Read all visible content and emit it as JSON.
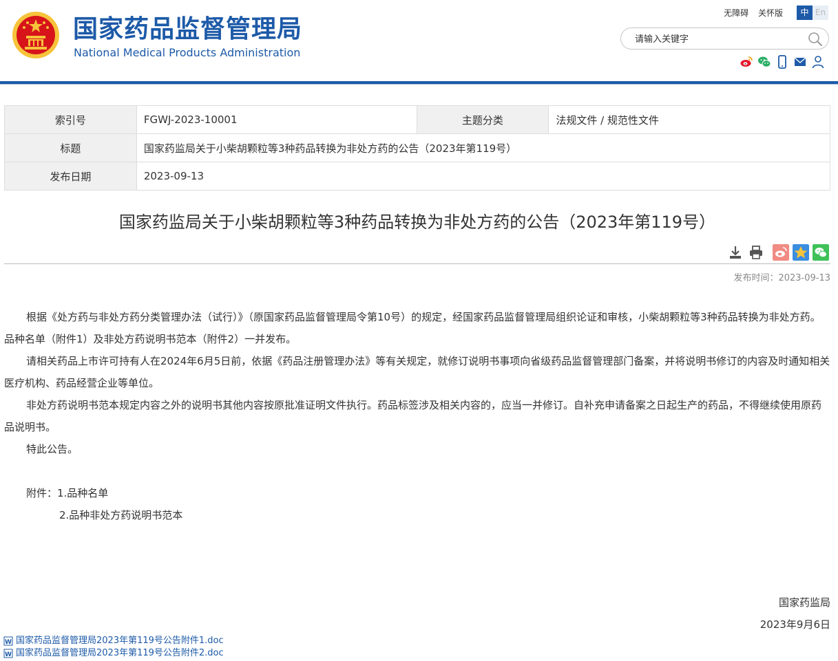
{
  "header": {
    "title_cn": "国家药品监督管理局",
    "title_en": "National Medical Products Administration",
    "accessibility": "无障碍",
    "elderly": "关怀版",
    "lang_zh": "中",
    "lang_en": "En",
    "search_placeholder": "请输入关键字",
    "share_icons": [
      "weibo-icon",
      "wechat-icon",
      "mobile-icon",
      "mail-icon",
      "user-icon"
    ]
  },
  "meta": {
    "index_label": "索引号",
    "index_value": "FGWJ-2023-10001",
    "category_label": "主题分类",
    "category_value": "法规文件 / 规范性文件",
    "title_label": "标题",
    "title_value": "国家药监局关于小柴胡颗粒等3种药品转换为非处方药的公告（2023年第119号）",
    "date_label": "发布日期",
    "date_value": "2023-09-13"
  },
  "article": {
    "title": "国家药监局关于小柴胡颗粒等3种药品转换为非处方药的公告（2023年第119号）",
    "publish_time": "发布时间：2023-09-13",
    "paragraphs": [
      "根据《处方药与非处方药分类管理办法（试行）》（原国家药品监督管理局令第10号）的规定，经国家药品监督管理局组织论证和审核，小柴胡颗粒等3种药品转换为非处方药。品种名单（附件1）及非处方药说明书范本（附件2）一并发布。",
      "请相关药品上市许可持有人在2024年6月5日前，依据《药品注册管理办法》等有关规定，就修订说明书事项向省级药品监督管理部门备案，并将说明书修订的内容及时通知相关医疗机构、药品经营企业等单位。",
      "非处方药说明书范本规定内容之外的说明书其他内容按原批准证明文件执行。药品标签涉及相关内容的，应当一并修订。自补充申请备案之日起生产的药品，不得继续使用原药品说明书。",
      "特此公告。"
    ],
    "attachment_1": "附件：1.品种名单",
    "attachment_2": "2.品种非处方药说明书范本",
    "signer": "国家药监局",
    "sign_date": "2023年9月6日",
    "files": [
      "国家药品监督管理局2023年第119号公告附件1.doc",
      "国家药品监督管理局2023年第119号公告附件2.doc"
    ]
  },
  "colors": {
    "brand_blue": "#1d5aa8",
    "emblem_red": "#d7141a",
    "emblem_gold": "#f6c33b"
  }
}
